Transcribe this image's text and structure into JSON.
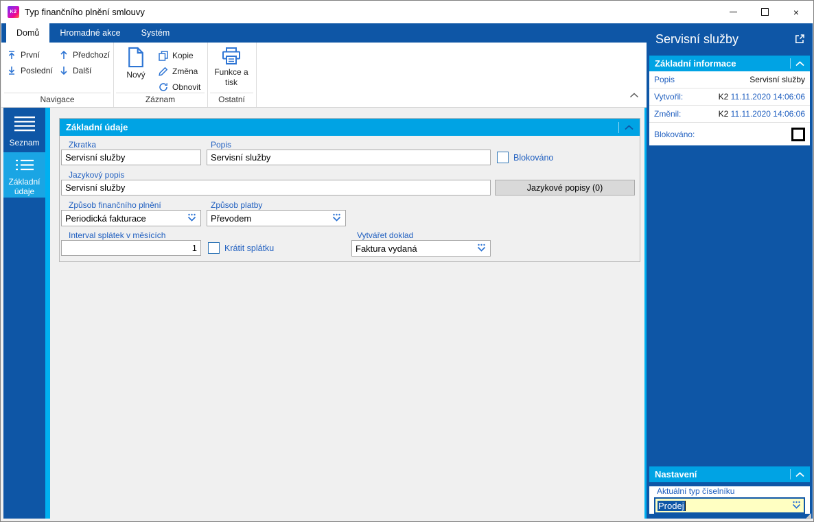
{
  "window": {
    "title": "Typ finančního plnění smlouvy",
    "logo_text": "K2",
    "controls": {
      "minimize": "−",
      "close": "×"
    }
  },
  "ribbon": {
    "tabs": [
      {
        "label": "Domů",
        "active": true
      },
      {
        "label": "Hromadné akce",
        "active": false
      },
      {
        "label": "Systém",
        "active": false
      }
    ],
    "navigace": {
      "label": "Navigace",
      "prvni": "První",
      "posledni": "Poslední",
      "predchozi": "Předchozí",
      "dalsi": "Další"
    },
    "zaznam": {
      "label": "Záznam",
      "novy": "Nový",
      "kopie": "Kopie",
      "zmena": "Změna",
      "obnovit": "Obnovit"
    },
    "ostatni": {
      "label": "Ostatní",
      "funkce_a_tisk": "Funkce a tisk"
    }
  },
  "sidebar": {
    "seznam": "Seznam",
    "zakladni_udaje": "Základní údaje",
    "active_item": "Základní údaje"
  },
  "form": {
    "title": "Základní údaje",
    "zkratka_label": "Zkratka",
    "zkratka_value": "Servisní služby",
    "popis_label": "Popis",
    "popis_value": "Servisní služby",
    "blokovano_label": "Blokováno",
    "blokovano_checked": false,
    "jazykovy_popis_label": "Jazykový popis",
    "jazykovy_popis_value": "Servisní služby",
    "jazykove_popisy_button": "Jazykové popisy (0)",
    "zpusob_plneni_label": "Způsob finančního plnění",
    "zpusob_plneni_value": "Periodická fakturace",
    "zpusob_platby_label": "Způsob platby",
    "zpusob_platby_value": "Převodem",
    "interval_label": "Interval splátek v měsících",
    "interval_value": "1",
    "kratit_label": "Krátit splátku",
    "kratit_checked": false,
    "vytvaret_label": "Vytvářet doklad",
    "vytvaret_value": "Faktura vydaná"
  },
  "right_panel": {
    "title": "Servisní služby",
    "info": {
      "title": "Základní informace",
      "popis_label": "Popis",
      "popis_value": "Servisní služby",
      "vytvoril_label": "Vytvořil:",
      "vytvoril_user": "K2",
      "vytvoril_datetime": "11.11.2020 14:06:06",
      "zmenil_label": "Změnil:",
      "zmenil_user": "K2",
      "zmenil_datetime": "11.11.2020 14:06:06",
      "blokovano_label": "Blokováno:",
      "blokovano_checked": false
    },
    "nastaveni": {
      "title": "Nastavení",
      "field_label": "Aktuální typ číselníku",
      "field_value": "Prodej"
    }
  },
  "colors": {
    "dark_blue": "#0e56a6",
    "light_blue_header": "#00a3e4",
    "cyan_strip": "#00b0f0",
    "label_blue": "#2160c0",
    "icon_blue": "#2e75d4",
    "focus_field_bg": "#ffffc2",
    "panel_bg": "#f0f0f0"
  }
}
